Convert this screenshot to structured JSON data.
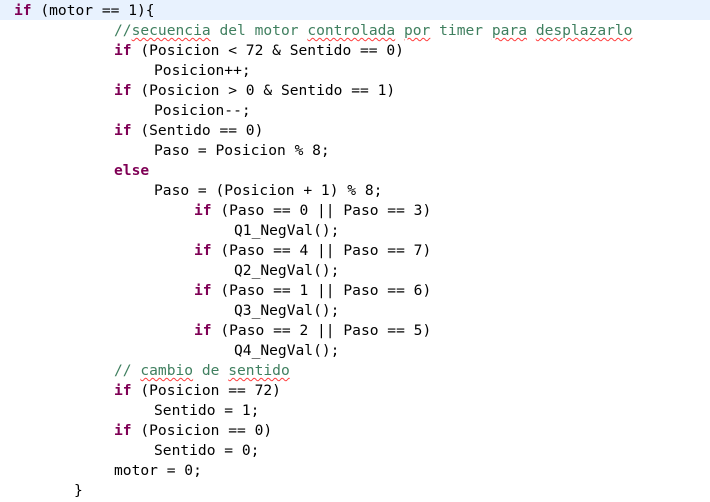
{
  "editor": {
    "lines": [
      {
        "segments": [
          {
            "t": "if",
            "s": "kw"
          },
          {
            "t": " (motor == 1){"
          }
        ]
      },
      {
        "segments": [
          {
            "t": "//",
            "s": "cmt"
          },
          {
            "t": "secuencia",
            "s": "cmt-spell"
          },
          {
            "t": " del motor ",
            "s": "cmt"
          },
          {
            "t": "controlada",
            "s": "cmt-spell"
          },
          {
            "t": " ",
            "s": "cmt"
          },
          {
            "t": "por",
            "s": "cmt-spell"
          },
          {
            "t": " timer ",
            "s": "cmt"
          },
          {
            "t": "para",
            "s": "cmt-spell"
          },
          {
            "t": " ",
            "s": "cmt"
          },
          {
            "t": "desplazarlo",
            "s": "cmt-spell"
          }
        ]
      },
      {
        "segments": [
          {
            "t": "if",
            "s": "kw"
          },
          {
            "t": " (Posicion < 72 & Sentido == 0)"
          }
        ]
      },
      {
        "segments": [
          {
            "t": "Posicion++;"
          }
        ]
      },
      {
        "segments": [
          {
            "t": "if",
            "s": "kw"
          },
          {
            "t": " (Posicion > 0 & Sentido == 1)"
          }
        ]
      },
      {
        "segments": [
          {
            "t": "Posicion--;"
          }
        ]
      },
      {
        "segments": [
          {
            "t": "if",
            "s": "kw"
          },
          {
            "t": " (Sentido == 0)"
          }
        ]
      },
      {
        "segments": [
          {
            "t": "Paso = Posicion % 8;"
          }
        ]
      },
      {
        "segments": [
          {
            "t": "else",
            "s": "kw"
          }
        ]
      },
      {
        "segments": [
          {
            "t": "Paso = (Posicion + 1) % 8;"
          }
        ]
      },
      {
        "segments": [
          {
            "t": "if",
            "s": "kw"
          },
          {
            "t": " (Paso == 0 || Paso == 3)"
          }
        ]
      },
      {
        "segments": [
          {
            "t": "Q1_NegVal();"
          }
        ]
      },
      {
        "segments": [
          {
            "t": "if",
            "s": "kw"
          },
          {
            "t": " (Paso == 4 || Paso == 7)"
          }
        ]
      },
      {
        "segments": [
          {
            "t": "Q2_NegVal();"
          }
        ]
      },
      {
        "segments": [
          {
            "t": "if",
            "s": "kw"
          },
          {
            "t": " (Paso == 1 || Paso == 6)"
          }
        ]
      },
      {
        "segments": [
          {
            "t": "Q3_NegVal();"
          }
        ]
      },
      {
        "segments": [
          {
            "t": "if",
            "s": "kw"
          },
          {
            "t": " (Paso == 2 || Paso == 5)"
          }
        ]
      },
      {
        "segments": [
          {
            "t": "Q4_NegVal();"
          }
        ]
      },
      {
        "segments": [
          {
            "t": "// ",
            "s": "cmt"
          },
          {
            "t": "cambio",
            "s": "cmt-spell"
          },
          {
            "t": " de ",
            "s": "cmt"
          },
          {
            "t": "sentido",
            "s": "cmt-spell"
          }
        ]
      },
      {
        "segments": [
          {
            "t": "if",
            "s": "kw"
          },
          {
            "t": " (Posicion == 72)"
          }
        ]
      },
      {
        "segments": [
          {
            "t": "Sentido = 1;"
          }
        ]
      },
      {
        "segments": [
          {
            "t": "if",
            "s": "kw"
          },
          {
            "t": " (Posicion == 0)"
          }
        ]
      },
      {
        "segments": [
          {
            "t": "Sentido = 0;"
          }
        ]
      },
      {
        "segments": [
          {
            "t": "motor = 0;"
          }
        ]
      },
      {
        "segments": [
          {
            "t": "}"
          }
        ]
      }
    ]
  },
  "colors": {
    "keyword": "#7f0055",
    "comment": "#3f7f5f",
    "text": "#000000",
    "current_line": "#e8f2fe",
    "spell_underline": "#ff3b3b"
  }
}
